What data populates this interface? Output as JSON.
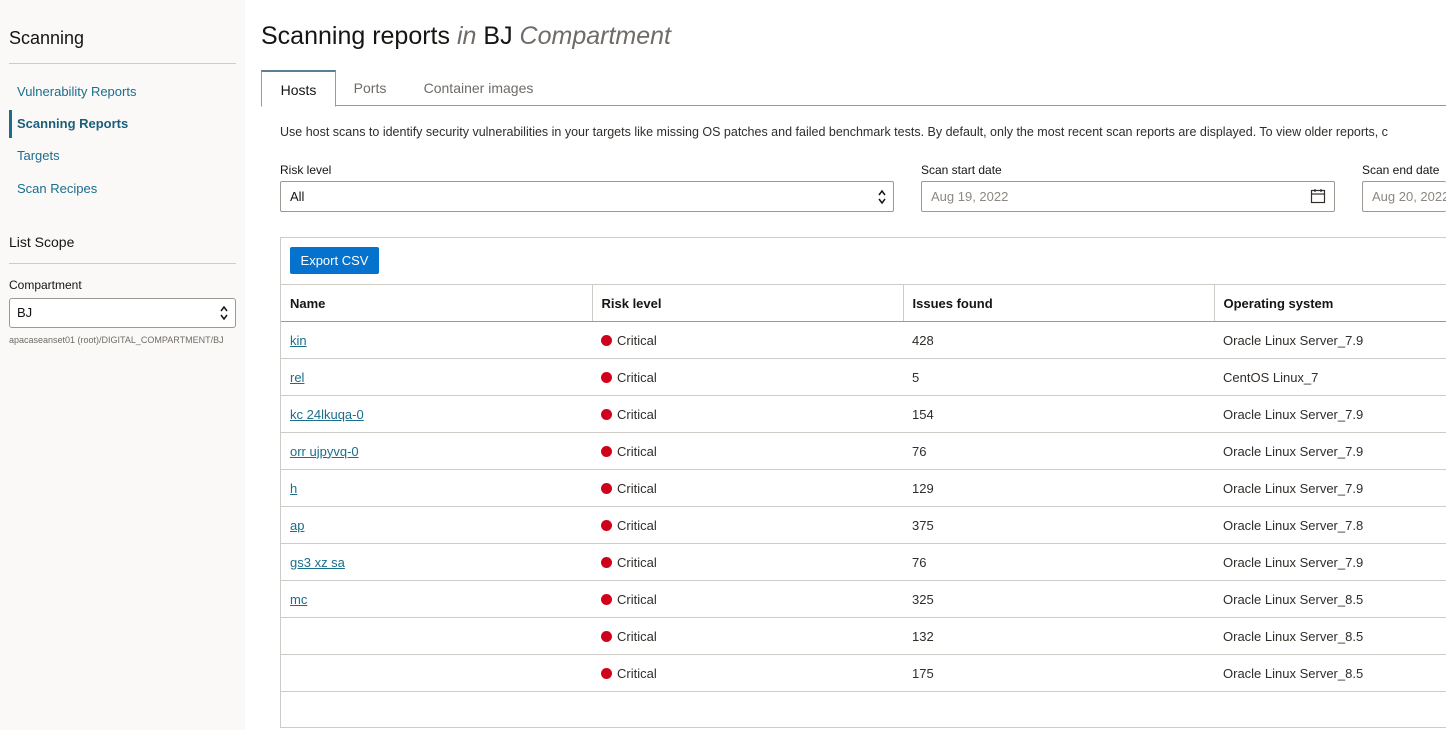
{
  "sidebar": {
    "title": "Scanning",
    "nav": [
      {
        "label": "Vulnerability Reports"
      },
      {
        "label": "Scanning Reports"
      },
      {
        "label": "Targets"
      },
      {
        "label": "Scan Recipes"
      }
    ],
    "active_nav": "Scanning Reports",
    "scope_title": "List Scope",
    "compartment_label": "Compartment",
    "compartment_value": "BJ",
    "compartment_path": "apacaseanset01 (root)/DIGITAL_COMPARTMENT/BJ"
  },
  "main": {
    "title": "Scanning reports",
    "title_in": "in",
    "title_compartment": "BJ",
    "title_compartment_suffix": "Compartment",
    "tabs": [
      {
        "label": "Hosts"
      },
      {
        "label": "Ports"
      },
      {
        "label": "Container images"
      }
    ],
    "active_tab": "Hosts",
    "description": "Use host scans to identify security vulnerabilities in your targets like missing OS patches and failed benchmark tests. By default, only the most recent scan reports are displayed. To view older reports, c",
    "filters": {
      "risk_label": "Risk level",
      "risk_value": "All",
      "start_label": "Scan start date",
      "start_value": "Aug 19, 2022",
      "end_label": "Scan end date",
      "end_value": "Aug 20, 2022"
    },
    "export_label": "Export CSV",
    "columns": [
      "Name",
      "Risk level",
      "Issues found",
      "Operating system"
    ],
    "rows": [
      {
        "name": "kin",
        "risk": "Critical",
        "issues": "428",
        "os": "Oracle Linux Server_7.9"
      },
      {
        "name": "rel",
        "risk": "Critical",
        "issues": "5",
        "os": "CentOS Linux_7"
      },
      {
        "name": "kc 24lkuqa-0",
        "risk": "Critical",
        "issues": "154",
        "os": "Oracle Linux Server_7.9"
      },
      {
        "name": "orr ujpyvq-0",
        "risk": "Critical",
        "issues": "76",
        "os": "Oracle Linux Server_7.9"
      },
      {
        "name": "h",
        "risk": "Critical",
        "issues": "129",
        "os": "Oracle Linux Server_7.9"
      },
      {
        "name": "ap",
        "risk": "Critical",
        "issues": "375",
        "os": "Oracle Linux Server_7.8"
      },
      {
        "name": "gs3 xz sa",
        "risk": "Critical",
        "issues": "76",
        "os": "Oracle Linux Server_7.9"
      },
      {
        "name": "mc",
        "risk": "Critical",
        "issues": "325",
        "os": "Oracle Linux Server_8.5"
      },
      {
        "name": "",
        "risk": "Critical",
        "issues": "132",
        "os": "Oracle Linux Server_8.5"
      },
      {
        "name": "",
        "risk": "Critical",
        "issues": "175",
        "os": "Oracle Linux Server_8.5"
      }
    ],
    "risk_color": "#d0021b",
    "accent": "#0572ce"
  }
}
